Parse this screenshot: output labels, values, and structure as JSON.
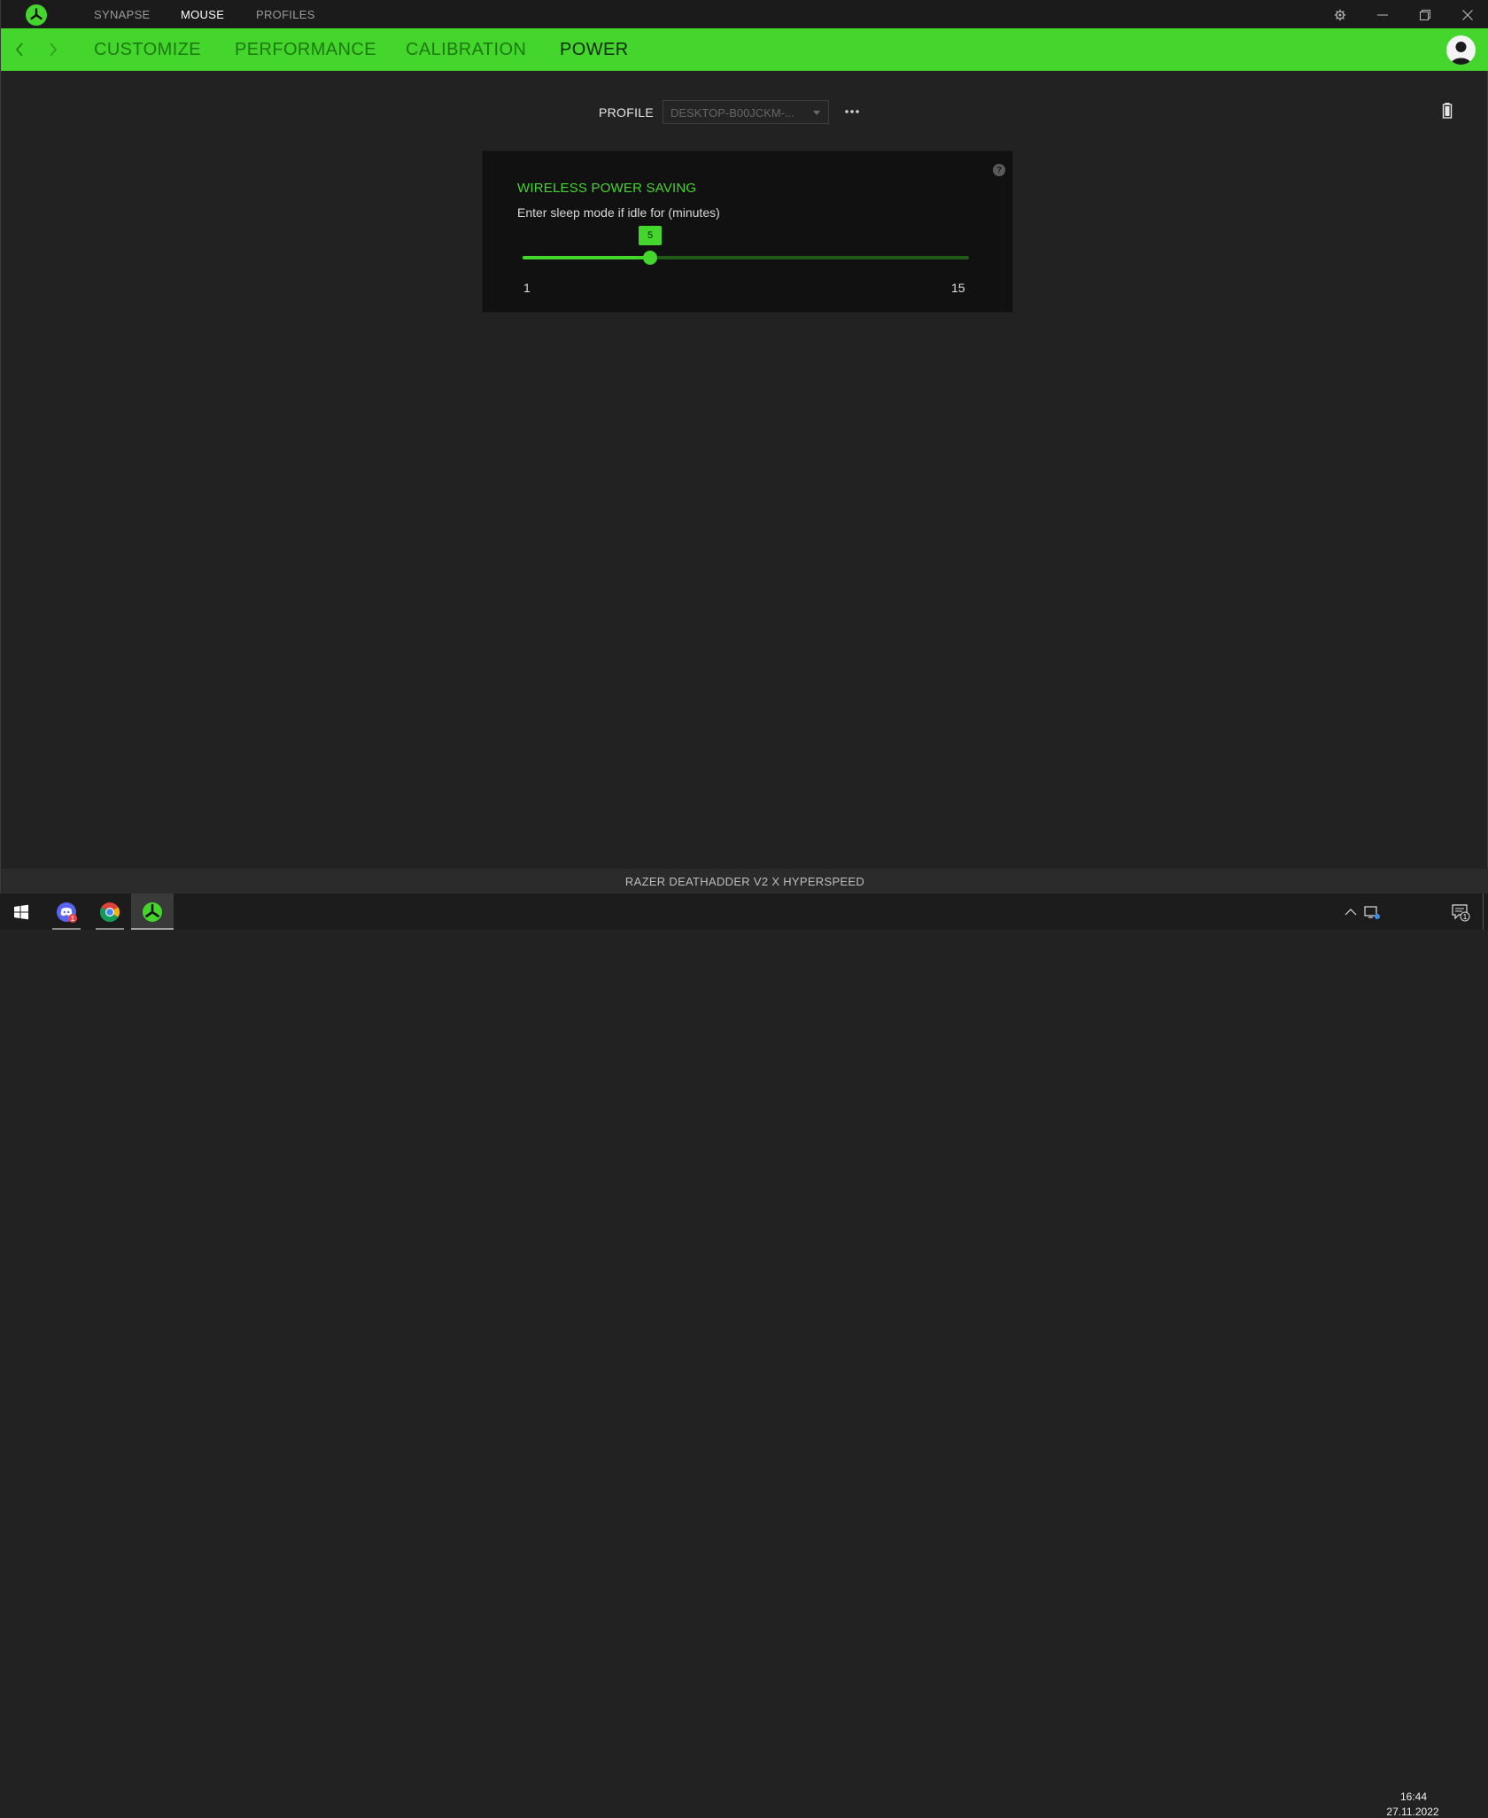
{
  "titlebar": {
    "tabs": [
      {
        "label": "SYNAPSE",
        "active": false
      },
      {
        "label": "MOUSE",
        "active": true
      },
      {
        "label": "PROFILES",
        "active": false
      }
    ]
  },
  "subnav": {
    "tabs": [
      {
        "label": "CUSTOMIZE",
        "active": false
      },
      {
        "label": "PERFORMANCE",
        "active": false
      },
      {
        "label": "CALIBRATION",
        "active": false
      },
      {
        "label": "POWER",
        "active": true
      }
    ]
  },
  "profile": {
    "label": "PROFILE",
    "selected": "DESKTOP-B00JCKM-..."
  },
  "power_card": {
    "title": "WIRELESS POWER SAVING",
    "subtitle": "Enter sleep mode if idle for (minutes)",
    "help": "?",
    "slider": {
      "min": 1,
      "max": 15,
      "value": 5,
      "min_label": "1",
      "max_label": "15",
      "value_label": "5"
    }
  },
  "device": {
    "name": "RAZER DEATHADDER V2 X HYPERSPEED"
  },
  "taskbar": {
    "apps": [
      {
        "icon": "discord-icon",
        "badge": "1"
      },
      {
        "icon": "chrome-icon"
      },
      {
        "icon": "razer-synapse-icon"
      }
    ],
    "time": "16:44",
    "date": "27.11.2022",
    "notification_count": "1"
  },
  "colors": {
    "accent": "#44d62c",
    "background": "#222222",
    "card": "#111111"
  }
}
